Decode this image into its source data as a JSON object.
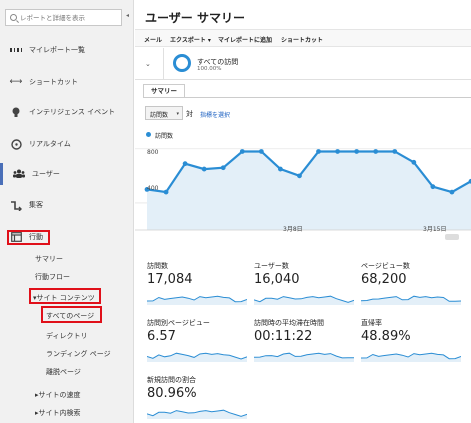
{
  "sidebar": {
    "search_placeholder": "レポートと詳細を表示",
    "collapse_icon": "◂",
    "items": [
      {
        "label": "マイレポート一覧",
        "icon": "grid-icon"
      },
      {
        "label": "ショートカット",
        "icon": "shortcut-arrows-icon"
      },
      {
        "label": "インテリジェンス イベント",
        "icon": "bulb-icon"
      },
      {
        "label": "リアルタイム",
        "icon": "realtime-clock-icon"
      },
      {
        "label": "ユーザー",
        "icon": "users-icon"
      },
      {
        "label": "集客",
        "icon": "acquisition-arrows-icon"
      },
      {
        "label": "行動",
        "icon": "behavior-window-icon"
      }
    ],
    "behavior_sub": [
      "サマリー",
      "行動フロー",
      "▾サイト コンテンツ",
      "すべてのページ",
      "ディレクトリ",
      "ランディング ページ",
      "離脱ページ",
      "▸サイトの速度",
      "▸サイト内検索"
    ]
  },
  "main": {
    "title": "ユーザー サマリー",
    "toolbar": [
      "メール",
      "エクスポート ▾",
      "マイレポートに追加",
      "ショートカット"
    ],
    "segment": {
      "name": "すべての訪問",
      "pct": "100.00%",
      "chevron": "⌄"
    },
    "tab": "サマリー",
    "metric_select": "訪問数",
    "metric_caret": "▾",
    "vs": "対",
    "pick_metric": "指標を選択",
    "legend": "訪問数"
  },
  "chart_data": {
    "type": "area",
    "series": [
      {
        "name": "訪問数",
        "values": [
          500,
          480,
          690,
          650,
          660,
          780,
          780,
          650,
          600,
          780,
          780,
          780,
          780,
          780,
          700,
          520,
          480,
          560
        ]
      }
    ],
    "yticks": [
      "800",
      "400"
    ],
    "xticks": [
      "3月8日",
      "3月15日"
    ],
    "color": "#2a8dd4",
    "fill": "#e3eff8"
  },
  "cards": [
    {
      "label": "訪問数",
      "value": "17,084"
    },
    {
      "label": "ユーザー数",
      "value": "16,040"
    },
    {
      "label": "ページビュー数",
      "value": "68,200"
    },
    {
      "label": "訪問別ページビュー",
      "value": "6.57"
    },
    {
      "label": "訪問時の平均滞在時間",
      "value": "00:11:22"
    },
    {
      "label": "直帰率",
      "value": "48.89%"
    },
    {
      "label": "新規訪問の割合",
      "value": "80.96%"
    }
  ]
}
